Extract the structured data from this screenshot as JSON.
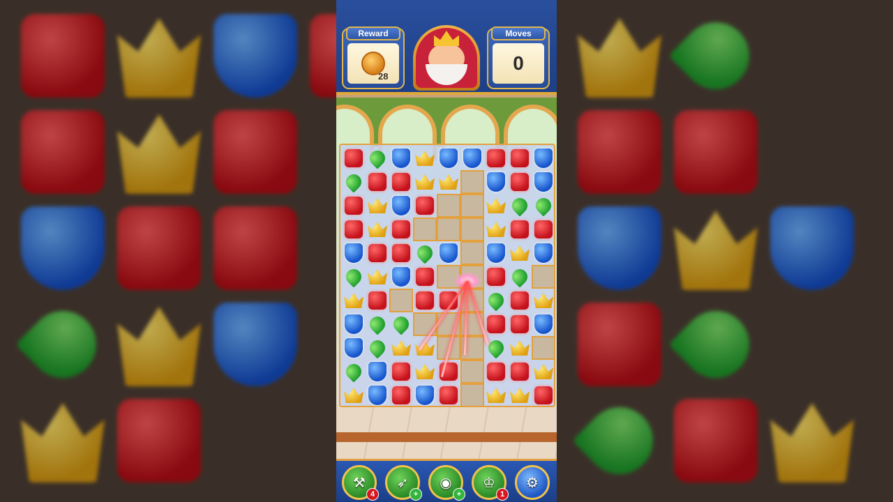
{
  "header": {
    "reward_label": "Reward",
    "reward_count": "28",
    "moves_label": "Moves",
    "moves_value": "0"
  },
  "boosters": [
    {
      "name": "hammer",
      "icon": "hammer-icon",
      "badge": "4",
      "badge_color": "#d8171f"
    },
    {
      "name": "arrow",
      "icon": "arrow-icon",
      "badge": "+",
      "badge_color": "#33b43a"
    },
    {
      "name": "cannon",
      "icon": "cannon-icon",
      "badge": "+",
      "badge_color": "#33b43a"
    },
    {
      "name": "jester-hat",
      "icon": "jester-hat-icon",
      "badge": "1",
      "badge_color": "#d8171f"
    },
    {
      "name": "settings",
      "icon": "gear-icon",
      "badge": ""
    }
  ],
  "board": {
    "cols": 9,
    "rows": 11,
    "legend": {
      "R": "red-gem",
      "B": "blue-gem",
      "G": "green-gem",
      "Y": "gold-crown",
      ".": "empty"
    },
    "grid": [
      "RGBYBBRRB",
      "GRRYY.BRB",
      "RYBR..YGG",
      "RYR...YRR",
      "BRRGB.BYB",
      "GYBR..RG.",
      "YR.RR.GRY",
      "BGG...RRB",
      "BGYY..GY.",
      "GBRYR.RRY",
      "YBRBR.YYR"
    ]
  },
  "colors": {
    "red": "#c4111b",
    "blue": "#1553cc",
    "green": "#21a030",
    "gold": "#e09f12",
    "header_blue": "#2a4f9c",
    "frame_gold": "#e3a03d"
  }
}
